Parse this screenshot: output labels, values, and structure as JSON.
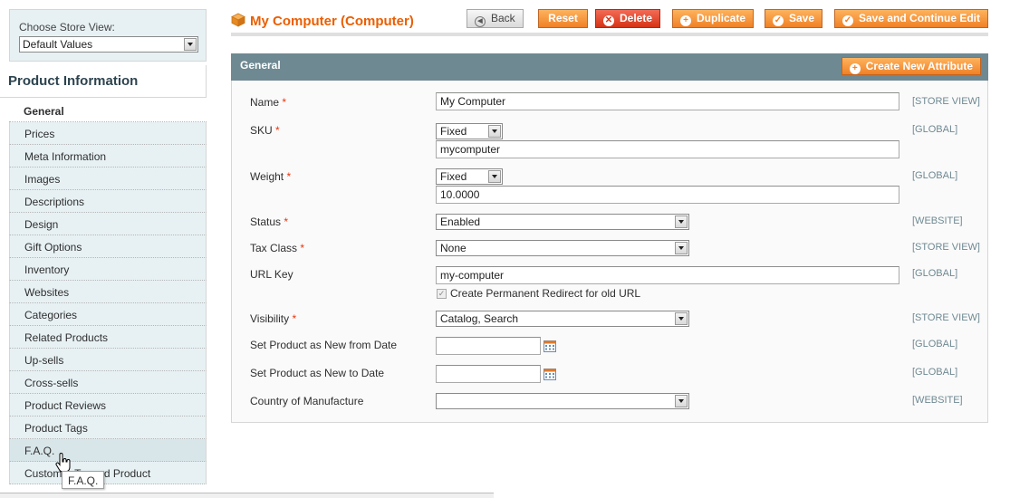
{
  "store_switcher": {
    "label": "Choose Store View:",
    "value": "Default Values"
  },
  "sidebar": {
    "title": "Product Information",
    "tabs": [
      "General",
      "Prices",
      "Meta Information",
      "Images",
      "Descriptions",
      "Design",
      "Gift Options",
      "Inventory",
      "Websites",
      "Categories",
      "Related Products",
      "Up-sells",
      "Cross-sells",
      "Product Reviews",
      "Product Tags",
      "F.A.Q.",
      "Customer Tagged Product"
    ],
    "tooltip": "F.A.Q."
  },
  "header": {
    "title": "My Computer (Computer)",
    "buttons": {
      "back": "Back",
      "reset": "Reset",
      "delete": "Delete",
      "duplicate": "Duplicate",
      "save": "Save",
      "save_continue": "Save and Continue Edit"
    }
  },
  "section": {
    "title": "General",
    "create_attribute": "Create New Attribute",
    "required_mark": "*",
    "fields": {
      "name": {
        "label": "Name",
        "value": "My Computer",
        "scope": "[STORE VIEW]"
      },
      "sku": {
        "label": "SKU",
        "mode": "Fixed",
        "value": "mycomputer",
        "scope": "[GLOBAL]"
      },
      "weight": {
        "label": "Weight",
        "mode": "Fixed",
        "value": "10.0000",
        "scope": "[GLOBAL]"
      },
      "status": {
        "label": "Status",
        "value": "Enabled",
        "scope": "[WEBSITE]"
      },
      "tax_class": {
        "label": "Tax Class",
        "value": "None",
        "scope": "[STORE VIEW]"
      },
      "url_key": {
        "label": "URL Key",
        "value": "my-computer",
        "scope": "[GLOBAL]",
        "redirect_label": "Create Permanent Redirect for old URL",
        "redirect_checked": true
      },
      "visibility": {
        "label": "Visibility",
        "value": "Catalog, Search",
        "scope": "[STORE VIEW]"
      },
      "new_from": {
        "label": "Set Product as New from Date",
        "value": "",
        "scope": "[GLOBAL]"
      },
      "new_to": {
        "label": "Set Product as New to Date",
        "value": "",
        "scope": "[GLOBAL]"
      },
      "country": {
        "label": "Country of Manufacture",
        "value": "",
        "scope": "[WEBSITE]"
      }
    }
  },
  "colors": {
    "accent_orange": "#f08127",
    "title_orange": "#eb5e00",
    "section_header": "#6f8992",
    "tab_bg": "#e7f1f4",
    "delete_red": "#d63215"
  }
}
